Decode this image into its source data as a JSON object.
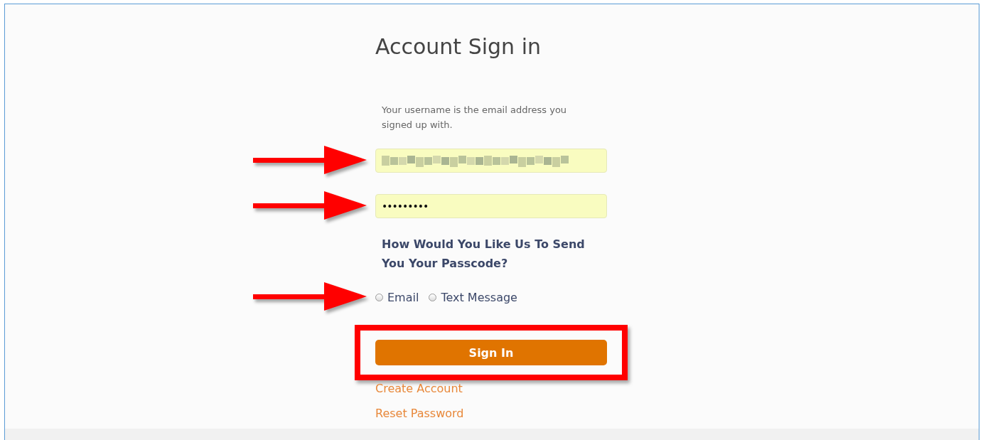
{
  "title": "Account Sign in",
  "hint": "Your username is the email address you signed up with.",
  "username": {
    "redacted": true,
    "marked": true
  },
  "password": {
    "value": "•••••••••",
    "marked": true
  },
  "question": "How Would You Like Us To Send You Your Passcode?",
  "delivery": {
    "marked": true,
    "options": [
      {
        "label": "Email",
        "selected": false
      },
      {
        "label": "Text Message",
        "selected": false
      }
    ]
  },
  "sign_in": {
    "label": "Sign In",
    "highlighted": true
  },
  "links": [
    "Create Account",
    "Reset Password"
  ]
}
